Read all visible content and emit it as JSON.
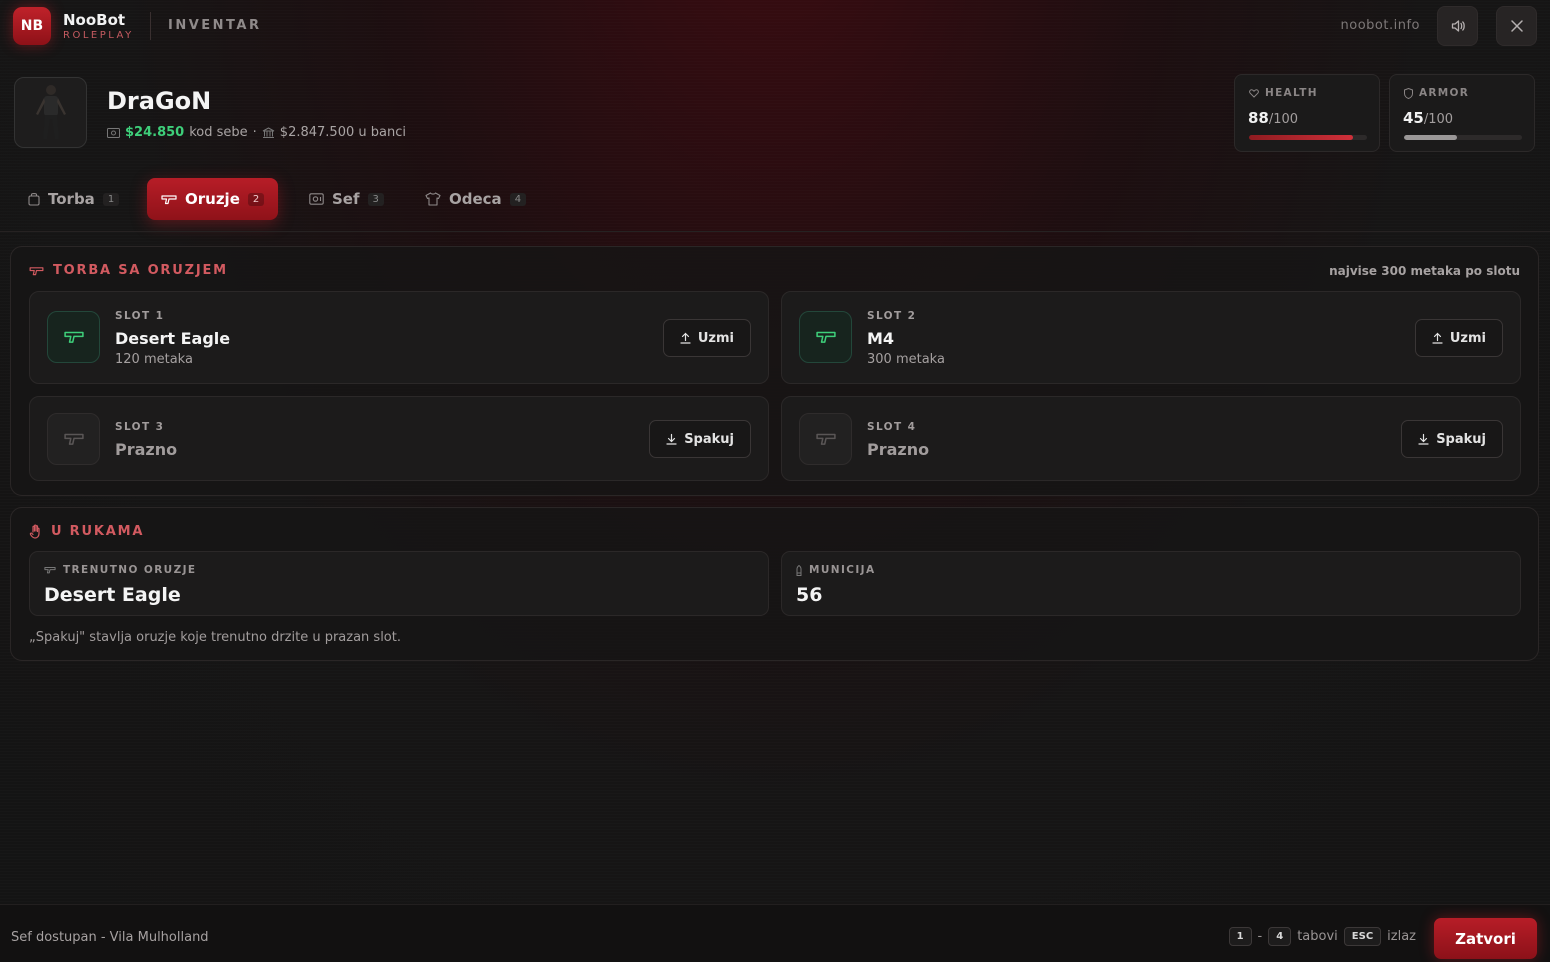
{
  "brand": {
    "badge": "NB",
    "name": "NooBot",
    "subtitle": "ROLEPLAY",
    "page_title": "INVENTAR",
    "site": "noobot.info"
  },
  "icons": {
    "sound": "speaker-icon",
    "close": "close-icon",
    "cash": "banknote-icon",
    "bank": "bank-icon",
    "health": "heart-icon",
    "armor": "shield-icon",
    "gun": "gun-icon",
    "hand": "hand-icon",
    "bullet": "bullet-icon",
    "upload": "upload-icon",
    "download": "download-icon",
    "bag": "bag-icon",
    "safe": "safe-icon",
    "shirt": "shirt-icon"
  },
  "player": {
    "name": "DraGoN",
    "cash": "$24.850",
    "cash_suffix": "kod sebe",
    "separator": "·",
    "bank": "$2.847.500 u banci"
  },
  "stats": {
    "health": {
      "label": "HEALTH",
      "value": "88",
      "max": "/100",
      "percent": 88
    },
    "armor": {
      "label": "ARMOR",
      "value": "45",
      "max": "/100",
      "percent": 45
    }
  },
  "tabs": [
    {
      "label": "Torba",
      "key": "1",
      "icon": "bag-icon"
    },
    {
      "label": "Oruzje",
      "key": "2",
      "icon": "gun-icon",
      "active": true
    },
    {
      "label": "Sef",
      "key": "3",
      "icon": "safe-icon"
    },
    {
      "label": "Odeca",
      "key": "4",
      "icon": "shirt-icon"
    }
  ],
  "weapons_panel": {
    "title": "TORBA SA ORUZJEM",
    "note": "najvise 300 metaka po slotu",
    "slots": [
      {
        "label": "SLOT 1",
        "weapon": "Desert Eagle",
        "ammo": "120 metaka",
        "button": "Uzmi"
      },
      {
        "label": "SLOT 2",
        "weapon": "M4",
        "ammo": "300 metaka",
        "button": "Uzmi"
      },
      {
        "label": "SLOT 3",
        "weapon": "Prazno",
        "button": "Spakuj"
      },
      {
        "label": "SLOT 4",
        "weapon": "Prazno",
        "button": "Spakuj"
      }
    ]
  },
  "hands_panel": {
    "title": "U RUKAMA",
    "current_label": "TRENUTNO ORUZJE",
    "current_value": "Desert Eagle",
    "ammo_label": "MUNICIJA",
    "ammo_value": "56",
    "hint": "„Spakuj\" stavlja oruzje koje trenutno drzite u prazan slot."
  },
  "footer": {
    "status": "Sef dostupan - Vila Mulholland",
    "key_from": "1",
    "key_dash": "-",
    "key_to": "4",
    "tabs_label": "tabovi",
    "esc_key": "ESC",
    "esc_label": "izlaz",
    "close_button": "Zatvori"
  },
  "colors": {
    "accent": "#b71d27",
    "cash": "#3ecf7a",
    "title": "#d25a60",
    "weapon_icon": "#3ecf7a"
  }
}
